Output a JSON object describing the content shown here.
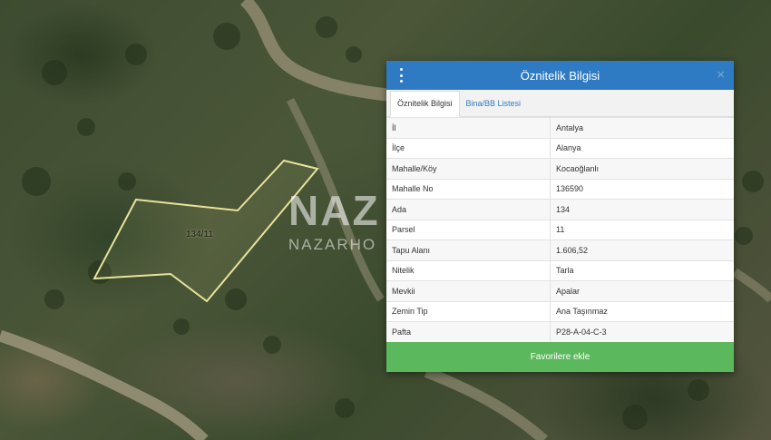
{
  "map": {
    "parcel_label": "134/11",
    "watermark": {
      "logo": "NAZ",
      "text": "NAZARHO"
    },
    "colors": {
      "parcel_outline": "#e8e39a",
      "road": "#9a9278"
    }
  },
  "panel": {
    "title": "Öznitelik Bilgisi",
    "close_symbol": "×",
    "menu_icon": "kebab-menu-icon",
    "tabs": [
      {
        "label": "Öznitelik Bilgisi",
        "active": true
      },
      {
        "label": "Bina/BB Listesi",
        "active": false
      }
    ],
    "rows": [
      {
        "key": "İl",
        "value": "Antalya"
      },
      {
        "key": "İlçe",
        "value": "Alanya"
      },
      {
        "key": "Mahalle/Köy",
        "value": "Kocaoğlanlı"
      },
      {
        "key": "Mahalle No",
        "value": "136590"
      },
      {
        "key": "Ada",
        "value": "134"
      },
      {
        "key": "Parsel",
        "value": "11"
      },
      {
        "key": "Tapu Alanı",
        "value": "1.606,52"
      },
      {
        "key": "Nitelik",
        "value": "Tarla"
      },
      {
        "key": "Mevkii",
        "value": "Apalar"
      },
      {
        "key": "Zemin Tip",
        "value": "Ana Taşınmaz"
      },
      {
        "key": "Pafta",
        "value": "P28-A-04-C-3"
      }
    ],
    "favorite_label": "Favorilere ekle",
    "colors": {
      "header": "#2f7bc3",
      "button": "#5cb85c"
    }
  }
}
